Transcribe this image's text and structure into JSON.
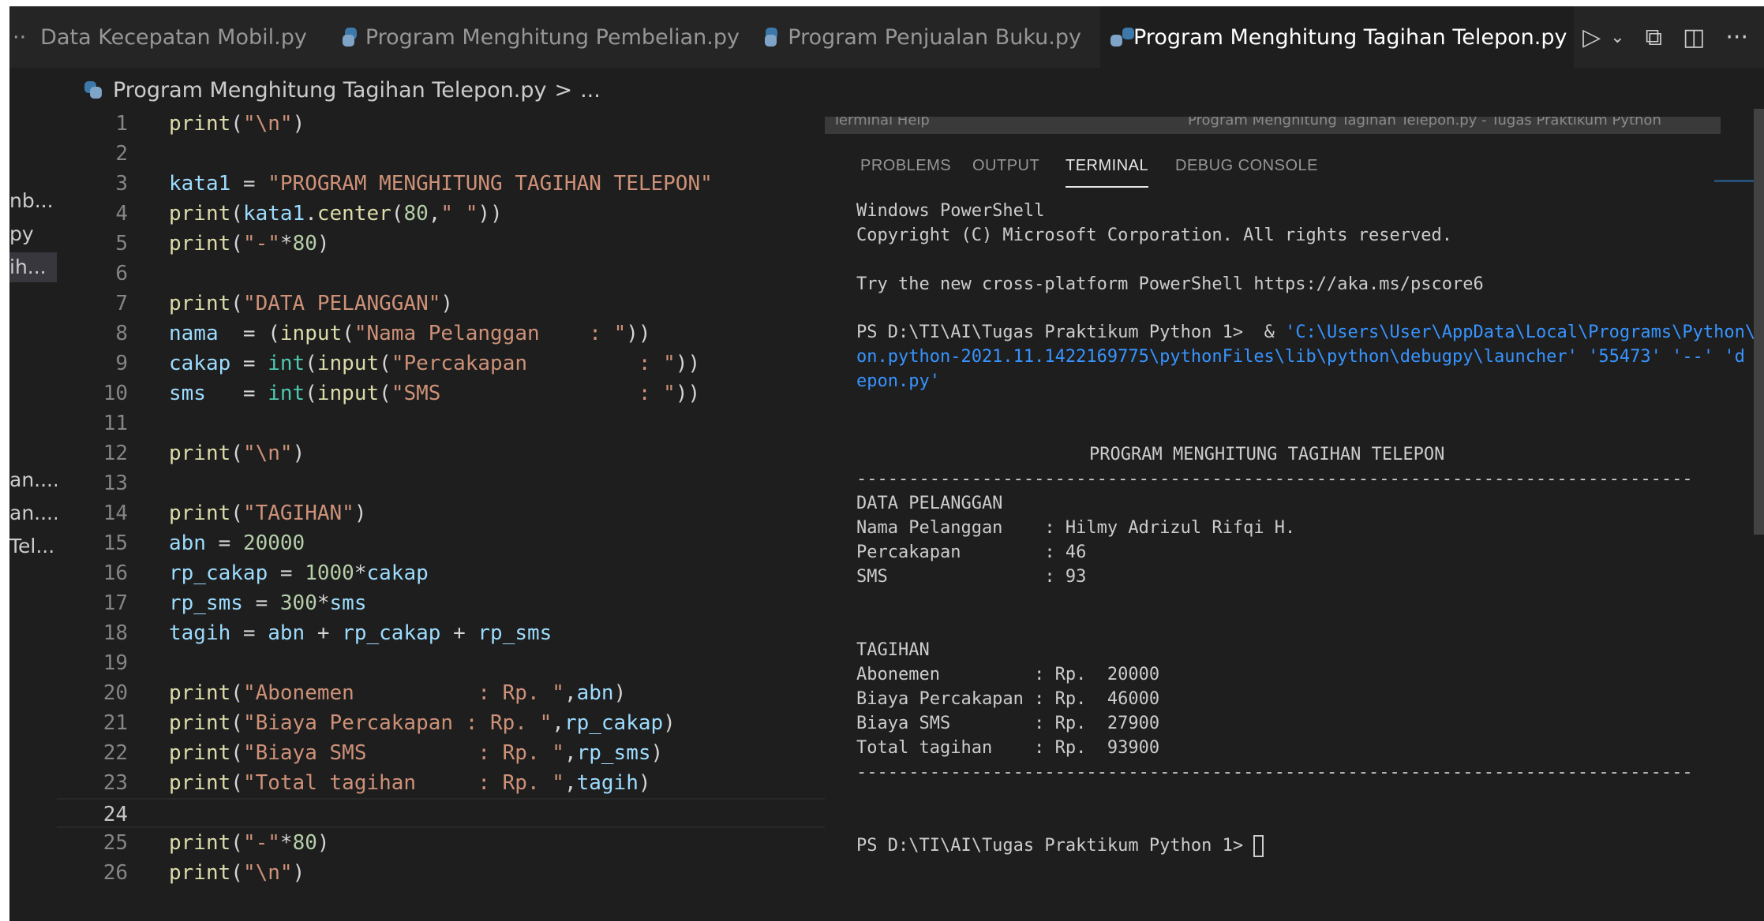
{
  "tabs": [
    {
      "label": "Data Kecepatan Mobil.py",
      "prefix": "··",
      "active": false,
      "icon": "python-icon"
    },
    {
      "label": "Program Menghitung Pembelian.py",
      "active": false,
      "icon": "python-icon"
    },
    {
      "label": "Program Penjualan Buku.py",
      "active": false,
      "icon": "python-icon"
    },
    {
      "label": "Program Menghitung Tagihan Telepon.py",
      "active": true,
      "icon": "python-icon",
      "modified": true
    }
  ],
  "toolbar": {
    "run": "▷",
    "run_menu": "⌄",
    "open_changes": "⧉",
    "split": "◫",
    "more": "···"
  },
  "breadcrumb": {
    "file": "Program Menghitung Tagihan Telepon.py",
    "separator": ">",
    "symbol": "..."
  },
  "explorer_fragments": [
    "nb...",
    "py",
    "ih...",
    "an....",
    "an....",
    "Tel..."
  ],
  "editor": {
    "current_line": 24,
    "lines": [
      {
        "n": "1"
      },
      {
        "n": "2"
      },
      {
        "n": "3"
      },
      {
        "n": "4"
      },
      {
        "n": "5"
      },
      {
        "n": "6"
      },
      {
        "n": "7"
      },
      {
        "n": "8"
      },
      {
        "n": "9"
      },
      {
        "n": "10"
      },
      {
        "n": "11"
      },
      {
        "n": "12"
      },
      {
        "n": "13"
      },
      {
        "n": "14"
      },
      {
        "n": "15"
      },
      {
        "n": "16"
      },
      {
        "n": "17"
      },
      {
        "n": "18"
      },
      {
        "n": "19"
      },
      {
        "n": "20"
      },
      {
        "n": "21"
      },
      {
        "n": "22"
      },
      {
        "n": "23"
      },
      {
        "n": "24"
      },
      {
        "n": "25"
      },
      {
        "n": "26"
      }
    ]
  },
  "code": {
    "print": "print",
    "input": "input",
    "int": "int",
    "center": "center",
    "newline_str": "\"\\n\"",
    "l3_var": "kata1",
    "l3_str": "\"PROGRAM MENGHITUNG TAGIHAN TELEPON\"",
    "l4_arg1": "80",
    "l4_str": "\" \"",
    "l5_str": "\"-\"",
    "l5_num": "80",
    "l7_str": "\"DATA PELANGGAN\"",
    "l8_var": "nama",
    "l8_str": "\"Nama Pelanggan    : \"",
    "l9_var": "cakap",
    "l9_str": "\"Percakapan         : \"",
    "l10_var": "sms",
    "l10_str": "\"SMS                : \"",
    "l14_str": "\"TAGIHAN\"",
    "l15_var": "abn",
    "l15_num": "20000",
    "l16_var": "rp_cakap",
    "l16_num": "1000",
    "l17_var": "rp_sms",
    "l17_num": "300",
    "l18_var": "tagih",
    "l20_str": "\"Abonemen          : Rp. \"",
    "l21_str": "\"Biaya Percakapan : Rp. \"",
    "l22_str": "\"Biaya SMS         : Rp. \"",
    "l23_str": "\"Total tagihan     : Rp. \""
  },
  "panel": {
    "ghost_menu_left": "Terminal   Help",
    "ghost_menu_mid": "Program Menghitung Tagihan Telepon.py - Tugas Praktikum Python",
    "tabs": [
      {
        "label": "PROBLEMS",
        "active": false
      },
      {
        "label": "OUTPUT",
        "active": false
      },
      {
        "label": "TERMINAL",
        "active": true
      },
      {
        "label": "DEBUG CONSOLE",
        "active": false
      }
    ]
  },
  "terminal": {
    "l1": "Windows PowerShell",
    "l2": "Copyright (C) Microsoft Corporation. All rights reserved.",
    "l3": "Try the new cross-platform PowerShell https://aka.ms/pscore6",
    "prompt": "PS D:\\TI\\AI\\Tugas Praktikum Python 1>",
    "cmd_amp": "&",
    "cmd_path1": "'C:\\Users\\User\\AppData\\Local\\Programs\\Python\\Pyth",
    "cmd_path2": "on.python-2021.11.1422169775\\pythonFiles\\lib\\python\\debugpy\\launcher' '55473' '--' 'd",
    "cmd_path3": "epon.py'",
    "title": "PROGRAM MENGHITUNG TAGIHAN TELEPON",
    "rule": "--------------------------------------------------------------------------------",
    "data_header": "DATA PELANGGAN",
    "nama": "Nama Pelanggan    : Hilmy Adrizul Rifqi H.",
    "percakapan": "Percakapan        : 46",
    "sms": "SMS               : 93",
    "tagihan_header": "TAGIHAN",
    "abonemen": "Abonemen         : Rp.  20000",
    "biaya_percakapan": "Biaya Percakapan : Rp.  46000",
    "biaya_sms": "Biaya SMS        : Rp.  27900",
    "total": "Total tagihan    : Rp.  93900",
    "final_prompt": "PS D:\\TI\\AI\\Tugas Praktikum Python 1>"
  }
}
